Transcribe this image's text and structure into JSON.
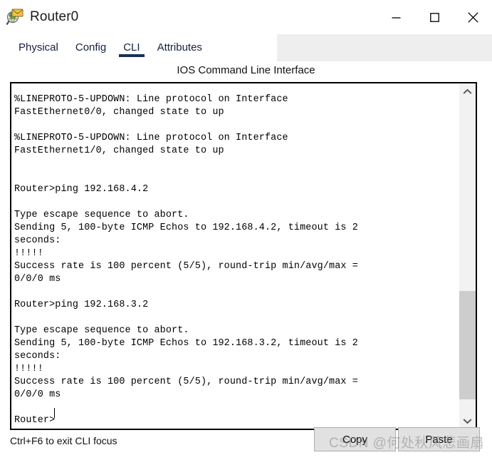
{
  "window": {
    "title": "Router0",
    "icon": "packet-tracer-router-icon",
    "controls": {
      "minimize": "—",
      "maximize": "□",
      "close": "✕"
    }
  },
  "tabs": [
    {
      "label": "Physical",
      "active": false
    },
    {
      "label": "Config",
      "active": false
    },
    {
      "label": "CLI",
      "active": true
    },
    {
      "label": "Attributes",
      "active": false
    }
  ],
  "panel": {
    "header": "IOS Command Line Interface"
  },
  "terminal": {
    "content": "%LINEPROTO-5-UPDOWN: Line protocol on Interface\nFastEthernet0/0, changed state to up\n\n%LINEPROTO-5-UPDOWN: Line protocol on Interface\nFastEthernet1/0, changed state to up\n\n\nRouter>ping 192.168.4.2\n\nType escape sequence to abort.\nSending 5, 100-byte ICMP Echos to 192.168.4.2, timeout is 2\nseconds:\n!!!!!\nSuccess rate is 100 percent (5/5), round-trip min/avg/max =\n0/0/0 ms\n\nRouter>ping 192.168.3.2\n\nType escape sequence to abort.\nSending 5, 100-byte ICMP Echos to 192.168.3.2, timeout is 2\nseconds:\n!!!!!\nSuccess rate is 100 percent (5/5), round-trip min/avg/max =\n0/0/0 ms\n\nRouter>",
    "prompt": "Router>",
    "commands": [
      "ping 192.168.4.2",
      "ping 192.168.3.2"
    ],
    "scrollbar": {
      "up_arrow": "⌃",
      "down_arrow": "⌄"
    }
  },
  "footer": {
    "hint": "Ctrl+F6 to exit CLI focus",
    "copy_label": "Copy",
    "paste_label": "Paste"
  },
  "watermark": {
    "text": "CSDN @何处秋风悲画扇"
  },
  "colors": {
    "tab_active_underline": "#1b2f56",
    "tab_text": "#16213e",
    "terminal_border": "#000000",
    "button_face": "#e1e1e1",
    "scrollbar_thumb": "#cdcdcd",
    "tabstrip_bg": "#eeeeee"
  }
}
